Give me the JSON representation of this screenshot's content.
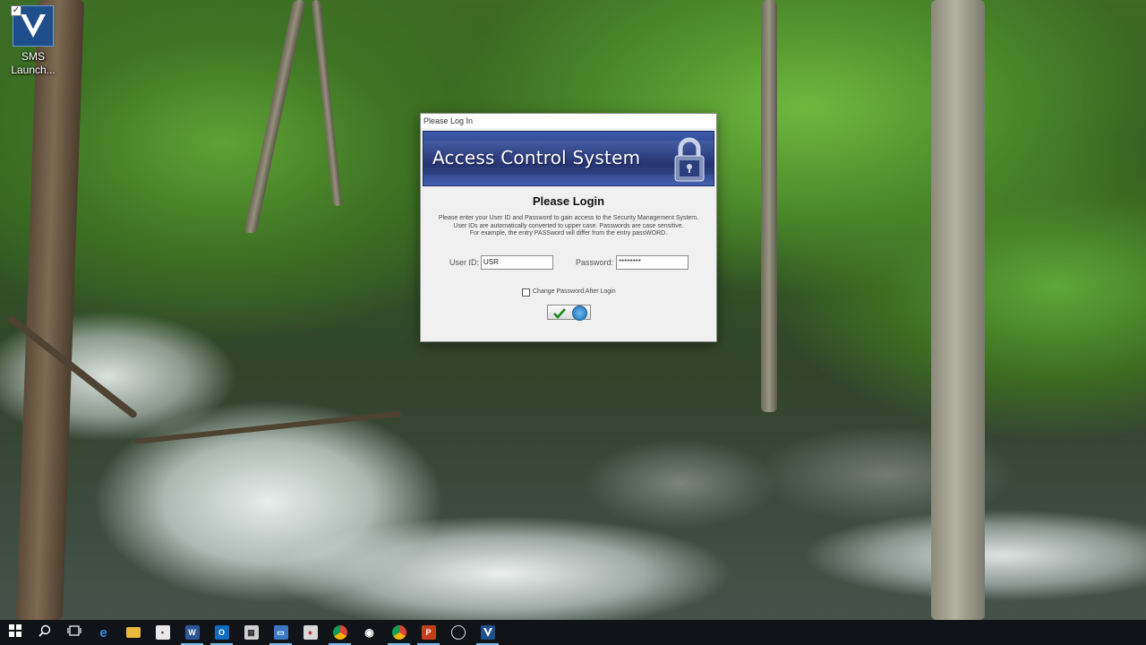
{
  "desktop": {
    "icon_label": "SMS Launch..."
  },
  "dialog": {
    "title": "Please Log In",
    "banner_title": "Access Control System",
    "heading": "Please Login",
    "info_line1": "Please enter your User ID and Password to gain access to the Security Management System.",
    "info_line2": "User IDs are automatically converted to upper case.  Passwords are case sensitive.",
    "info_line3": "For example, the entry PASSword will differ from the entry passWORD.",
    "user_id_label": "User ID:",
    "user_id_value": "USR",
    "password_label": "Password:",
    "password_value": "********",
    "change_password_label": "Change Password After Login",
    "change_password_checked": false
  },
  "taskbar": {
    "items": [
      "start",
      "search",
      "task-view",
      "edge",
      "file-explorer",
      "store",
      "word",
      "outlook",
      "calculator",
      "remote-desktop",
      "paint",
      "chrome",
      "camera",
      "chrome-alt",
      "powerpoint",
      "clock",
      "sms-launcher"
    ],
    "accent": "#76b9ed"
  }
}
